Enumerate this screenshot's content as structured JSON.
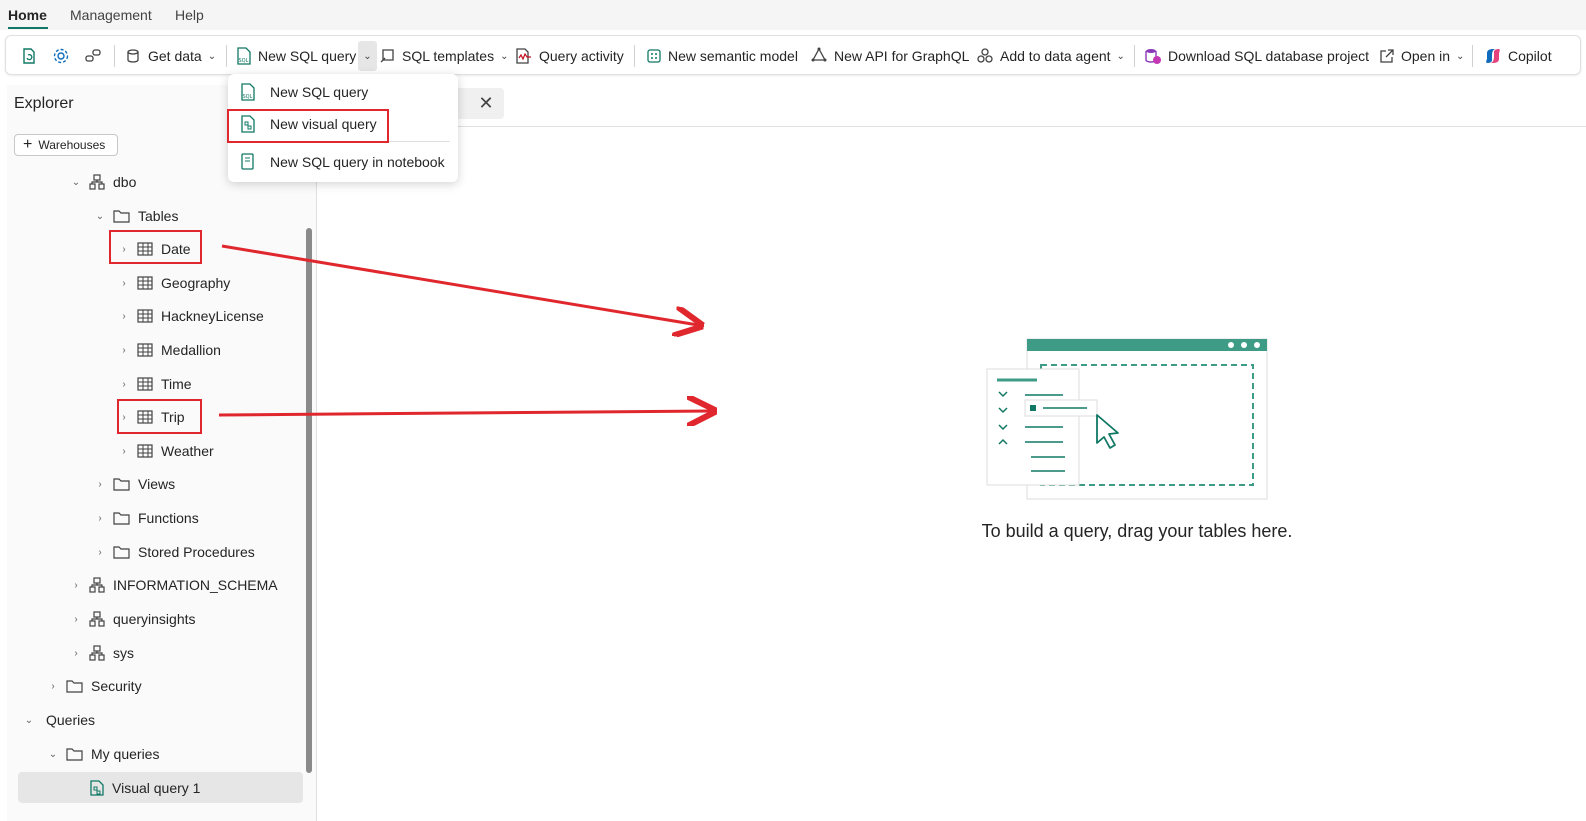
{
  "menu": {
    "tabs": [
      "Home",
      "Management",
      "Help"
    ]
  },
  "ribbon": {
    "get_data": "Get data",
    "new_sql_query": "New SQL query",
    "sql_templates": "SQL templates",
    "query_activity": "Query activity",
    "new_semantic_model": "New semantic model",
    "new_api_graphql": "New API for GraphQL",
    "add_to_data_agent": "Add to data agent",
    "download_sql_project": "Download SQL database project",
    "open_in": "Open in",
    "copilot": "Copilot"
  },
  "dropdown": {
    "items": [
      "New SQL query",
      "New visual query",
      "New SQL query in notebook"
    ]
  },
  "explorer": {
    "title": "Explorer",
    "warehouses_button": "Warehouses",
    "tree": {
      "schema_dbo": "dbo",
      "tables_folder": "Tables",
      "tables": [
        "Date",
        "Geography",
        "HackneyLicense",
        "Medallion",
        "Time",
        "Trip",
        "Weather"
      ],
      "views": "Views",
      "functions": "Functions",
      "stored_procedures": "Stored Procedures",
      "information_schema": "INFORMATION_SCHEMA",
      "queryinsights": "queryinsights",
      "sys": "sys",
      "security": "Security",
      "queries": "Queries",
      "my_queries": "My queries",
      "visual_query": "Visual query 1"
    }
  },
  "canvas": {
    "empty_message": "To build a query, drag your tables here."
  },
  "colors": {
    "accent": "#117865",
    "annotation": "#e0272d",
    "selected_row": "#e6e6e6"
  }
}
